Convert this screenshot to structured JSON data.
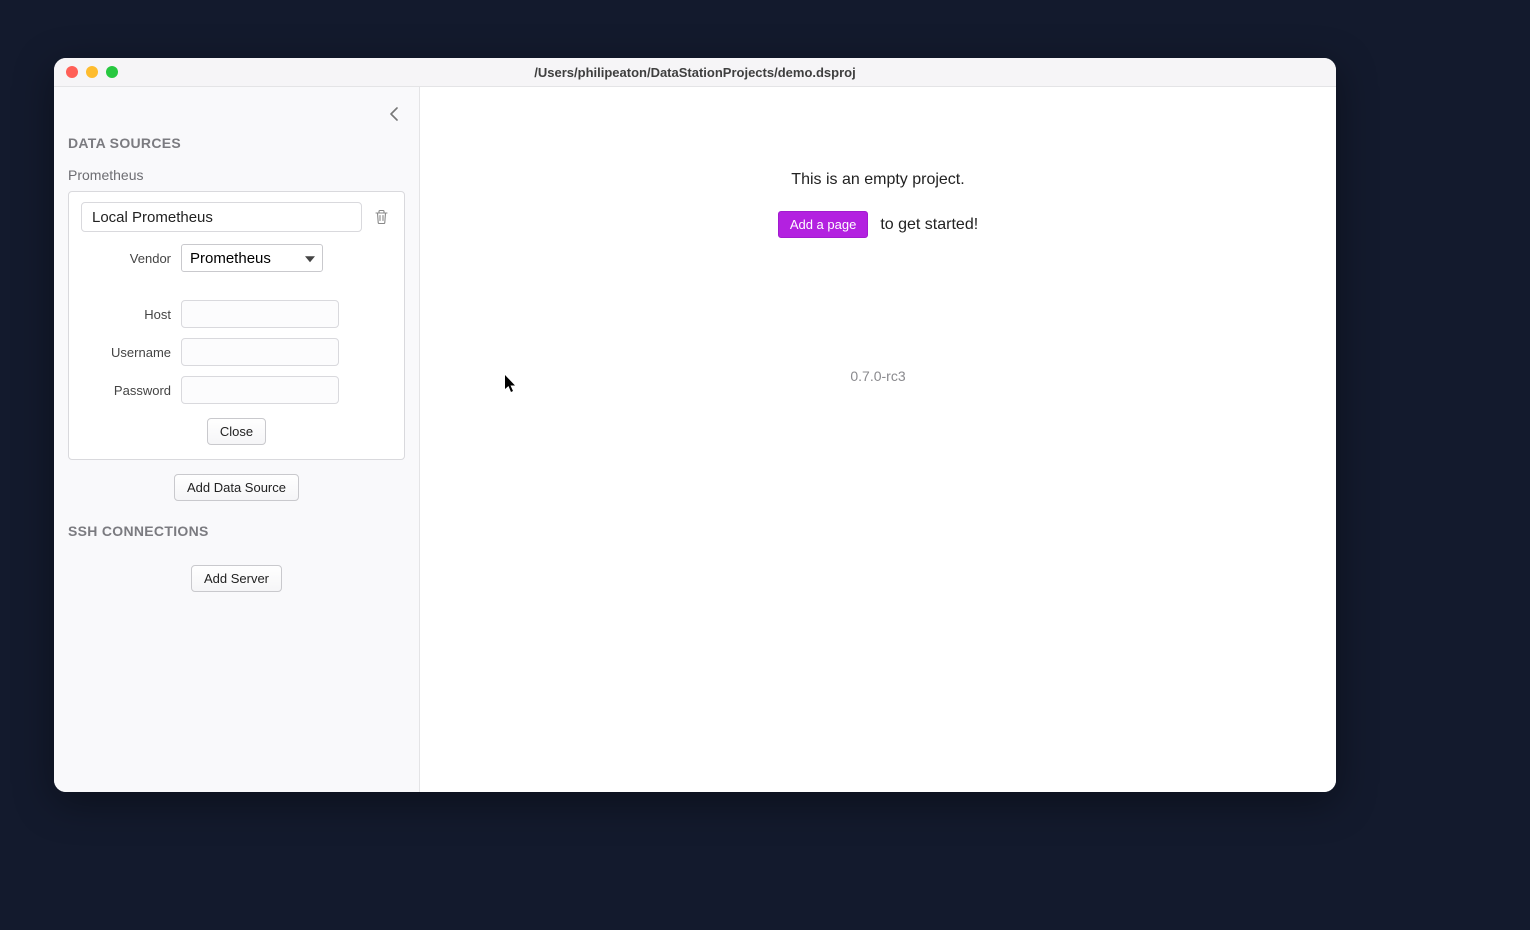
{
  "window": {
    "title": "/Users/philipeaton/DataStationProjects/demo.dsproj"
  },
  "sidebar": {
    "sections": {
      "data_sources": {
        "title": "DATA SOURCES"
      },
      "ssh": {
        "title": "SSH CONNECTIONS"
      }
    },
    "data_source": {
      "type_label": "Prometheus",
      "name_value": "Local Prometheus",
      "fields": {
        "vendor": {
          "label": "Vendor",
          "value": "Prometheus"
        },
        "host": {
          "label": "Host",
          "value": ""
        },
        "username": {
          "label": "Username",
          "value": ""
        },
        "password": {
          "label": "Password",
          "value": ""
        }
      },
      "close_label": "Close"
    },
    "add_data_source_label": "Add Data Source",
    "add_server_label": "Add Server"
  },
  "main": {
    "empty_text": "This is an empty project.",
    "add_page_label": "Add a page",
    "get_started_text": "to get started!",
    "version": "0.7.0-rc3"
  }
}
